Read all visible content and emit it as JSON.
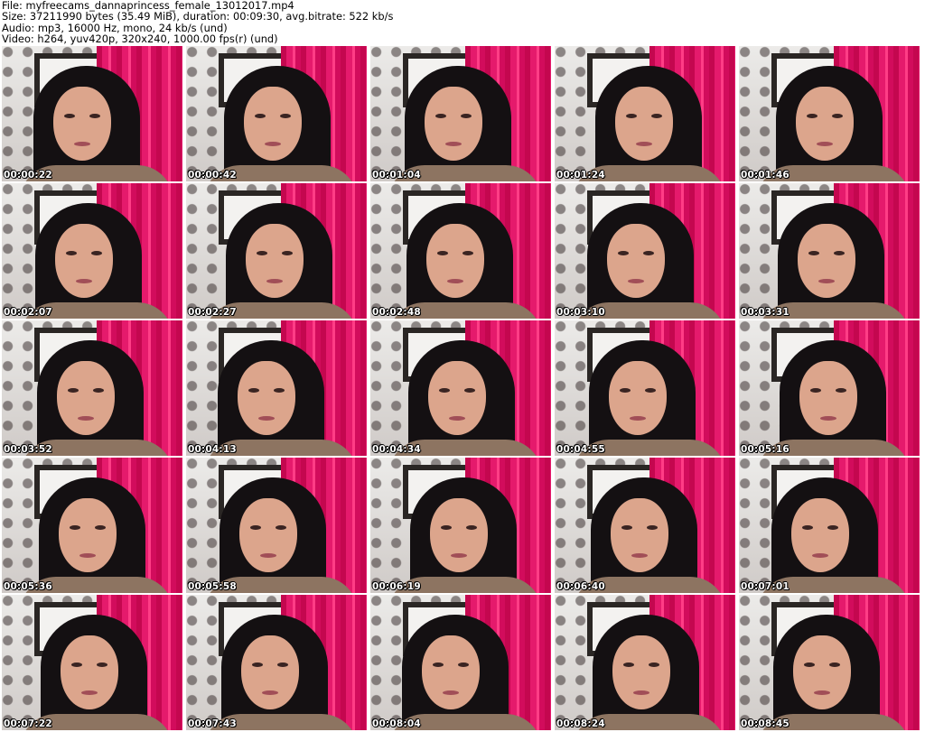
{
  "header": {
    "file_line": "File: myfreecams_dannaprincess_female_13012017.mp4",
    "size_line": "Size: 37211990 bytes (35.49 MiB), duration: 00:09:30, avg.bitrate: 522 kb/s",
    "audio_line": "Audio: mp3, 16000 Hz, mono, 24 kb/s (und)",
    "video_line": "Video: h264, yuv420p, 320x240, 1000.00 fps(r) (und)"
  },
  "thumbnails": [
    "00:00:22",
    "00:00:42",
    "00:01:04",
    "00:01:24",
    "00:01:46",
    "00:02:07",
    "00:02:27",
    "00:02:48",
    "00:03:10",
    "00:03:31",
    "00:03:52",
    "00:04:13",
    "00:04:34",
    "00:04:55",
    "00:05:16",
    "00:05:36",
    "00:05:58",
    "00:06:19",
    "00:06:40",
    "00:07:01",
    "00:07:22",
    "00:07:43",
    "00:08:04",
    "00:08:24",
    "00:08:45"
  ],
  "colors": {
    "background": "#ffffff",
    "curtain": "#e51a6c",
    "hair": "#141012",
    "timestamp_text": "#ffffff"
  }
}
